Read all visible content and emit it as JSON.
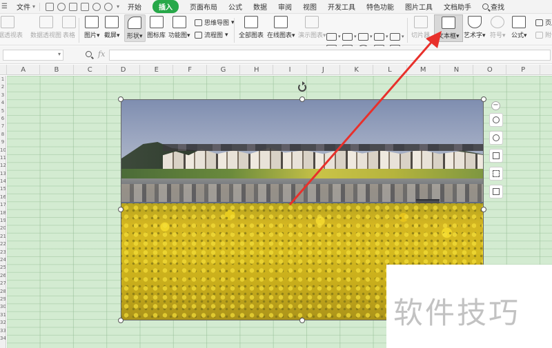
{
  "menubar": {
    "file_label": "文件",
    "tabs": [
      "开始",
      "插入",
      "页面布局",
      "公式",
      "数据",
      "审阅",
      "视图",
      "开发工具",
      "特色功能",
      "图片工具",
      "文档助手"
    ],
    "active_tab": "插入",
    "search_label": "查找"
  },
  "ribbon": {
    "pivot_table": "数据透视表",
    "pivot_chart": "数据透视图",
    "table": "表格",
    "picture": "图片",
    "screenshot": "截屏",
    "shape": "形状",
    "icon_library": "图标库",
    "function_chart": "功能图",
    "mind_map": "思维导图",
    "flowchart": "流程图",
    "all_charts": "全部图表",
    "online_charts": "在线图表",
    "demo_charts": "演示图表",
    "slicer": "切片器",
    "text_box": "文本框",
    "wordart": "艺术字",
    "symbol": "符号",
    "formula": "公式",
    "header_footer": "页眉",
    "attachment": "附件"
  },
  "formula_bar": {
    "fx_label": "fx",
    "name_box_value": "",
    "formula_value": ""
  },
  "columns": [
    "A",
    "B",
    "C",
    "D",
    "E",
    "F",
    "G",
    "H",
    "I",
    "J",
    "K",
    "L",
    "M",
    "N",
    "O",
    "P"
  ],
  "rows": [
    "1",
    "2",
    "3",
    "4",
    "5",
    "6",
    "7",
    "8",
    "9",
    "10",
    "11",
    "12",
    "13",
    "14",
    "15",
    "16",
    "17",
    "18",
    "19",
    "20",
    "21",
    "22",
    "23",
    "24",
    "25",
    "26",
    "27",
    "28",
    "29",
    "30",
    "31",
    "32",
    "33",
    "34"
  ],
  "watermark": "软件技巧",
  "colors": {
    "active_tab_bg": "#27a849",
    "sheet_bg": "#d3ebd1",
    "annotation_arrow": "#e8302b",
    "watermark_text": "#c2c2c2"
  },
  "float_tools": [
    "zoom-icon",
    "link-icon",
    "crop-icon",
    "fit-icon",
    "replace-picture-icon"
  ]
}
